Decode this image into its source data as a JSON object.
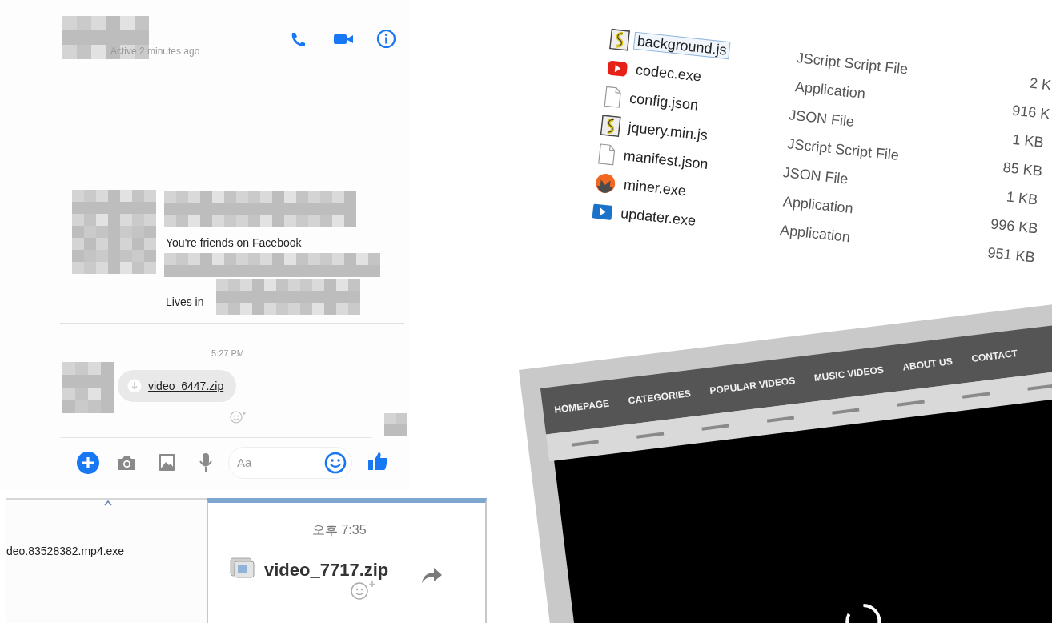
{
  "messenger": {
    "status": "Active 2 minutes ago",
    "profile_lines": [
      "You're friends on Facebook",
      "Lives in"
    ],
    "timestamp": "5:27 PM",
    "attachment": "video_6447.zip",
    "composer_placeholder": "Aa"
  },
  "download_bar": {
    "filename": "deo.83528382.mp4.exe"
  },
  "chat_preview": {
    "timestamp": "오후 7:35",
    "attachment": "video_7717.zip"
  },
  "file_list": {
    "rows": [
      {
        "name": "background.js",
        "type": "JScript Script File",
        "size": "2 K",
        "kind": "script",
        "selected": true
      },
      {
        "name": "codec.exe",
        "type": "Application",
        "size": "916 K",
        "kind": "red-play",
        "selected": false
      },
      {
        "name": "config.json",
        "type": "JSON File",
        "size": "1 KB",
        "kind": "document",
        "selected": false
      },
      {
        "name": "jquery.min.js",
        "type": "JScript Script File",
        "size": "85 KB",
        "kind": "script",
        "selected": false
      },
      {
        "name": "manifest.json",
        "type": "JSON File",
        "size": "1 KB",
        "kind": "document",
        "selected": false
      },
      {
        "name": "miner.exe",
        "type": "Application",
        "size": "996 KB",
        "kind": "coin",
        "selected": false
      },
      {
        "name": "updater.exe",
        "type": "Application",
        "size": "951 KB",
        "kind": "blue-play",
        "selected": false
      }
    ]
  },
  "video_site": {
    "nav": [
      "HOMEPAGE",
      "CATEGORIES",
      "POPULAR VIDEOS",
      "MUSIC VIDEOS",
      "ABOUT US",
      "CONTACT"
    ]
  }
}
